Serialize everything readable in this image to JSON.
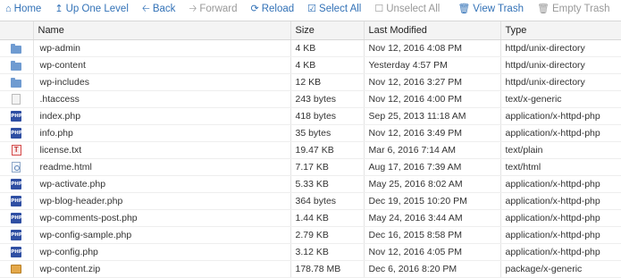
{
  "toolbar": {
    "home": "Home",
    "up_one_level": "Up One Level",
    "back": "Back",
    "forward": "Forward",
    "reload": "Reload",
    "select_all": "Select All",
    "unselect_all": "Unselect All",
    "view_trash": "View Trash",
    "empty_trash": "Empty Trash"
  },
  "columns": {
    "name": "Name",
    "size": "Size",
    "last_modified": "Last Modified",
    "type": "Type"
  },
  "files": [
    {
      "icon": "folder-icon",
      "name": "wp-admin",
      "size": "4 KB",
      "modified": "Nov 12, 2016 4:08 PM",
      "type": "httpd/unix-directory"
    },
    {
      "icon": "folder-icon",
      "name": "wp-content",
      "size": "4 KB",
      "modified": "Yesterday 4:57 PM",
      "type": "httpd/unix-directory"
    },
    {
      "icon": "folder-icon",
      "name": "wp-includes",
      "size": "12 KB",
      "modified": "Nov 12, 2016 3:27 PM",
      "type": "httpd/unix-directory"
    },
    {
      "icon": "document-icon",
      "name": ".htaccess",
      "size": "243 bytes",
      "modified": "Nov 12, 2016 4:00 PM",
      "type": "text/x-generic"
    },
    {
      "icon": "php-file-icon",
      "name": "index.php",
      "size": "418 bytes",
      "modified": "Sep 25, 2013 11:18 AM",
      "type": "application/x-httpd-php"
    },
    {
      "icon": "php-file-icon",
      "name": "info.php",
      "size": "35 bytes",
      "modified": "Nov 12, 2016 3:49 PM",
      "type": "application/x-httpd-php"
    },
    {
      "icon": "text-file-icon",
      "name": "license.txt",
      "size": "19.47 KB",
      "modified": "Mar 6, 2016 7:14 AM",
      "type": "text/plain"
    },
    {
      "icon": "html-file-icon",
      "name": "readme.html",
      "size": "7.17 KB",
      "modified": "Aug 17, 2016 7:39 AM",
      "type": "text/html"
    },
    {
      "icon": "php-file-icon",
      "name": "wp-activate.php",
      "size": "5.33 KB",
      "modified": "May 25, 2016 8:02 AM",
      "type": "application/x-httpd-php"
    },
    {
      "icon": "php-file-icon",
      "name": "wp-blog-header.php",
      "size": "364 bytes",
      "modified": "Dec 19, 2015 10:20 PM",
      "type": "application/x-httpd-php"
    },
    {
      "icon": "php-file-icon",
      "name": "wp-comments-post.php",
      "size": "1.44 KB",
      "modified": "May 24, 2016 3:44 AM",
      "type": "application/x-httpd-php"
    },
    {
      "icon": "php-file-icon",
      "name": "wp-config-sample.php",
      "size": "2.79 KB",
      "modified": "Dec 16, 2015 8:58 PM",
      "type": "application/x-httpd-php"
    },
    {
      "icon": "php-file-icon",
      "name": "wp-config.php",
      "size": "3.12 KB",
      "modified": "Nov 12, 2016 4:05 PM",
      "type": "application/x-httpd-php"
    },
    {
      "icon": "zip-file-icon",
      "name": "wp-content.zip",
      "size": "178.78 MB",
      "modified": "Dec 6, 2016 8:20 PM",
      "type": "package/x-generic"
    }
  ],
  "colors": {
    "link": "#3372b7",
    "disabled": "#999999",
    "header_bg": "#f4f4f4"
  }
}
